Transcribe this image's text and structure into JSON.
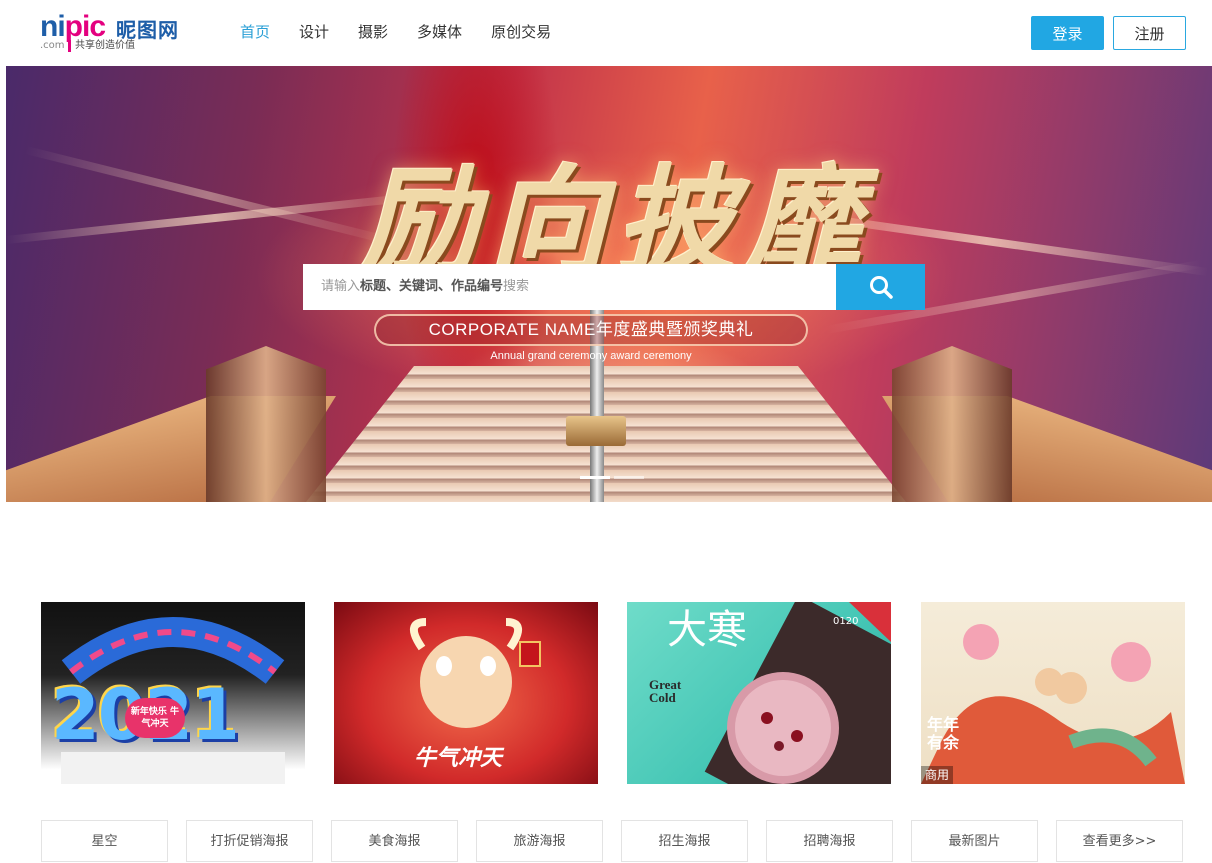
{
  "header": {
    "logo": {
      "ni": "ni",
      "pic": "pic",
      "cn": "昵图网",
      "com": ".com",
      "slogan": "共享创造价值"
    },
    "nav": [
      {
        "label": "首页",
        "active": true
      },
      {
        "label": "设计"
      },
      {
        "label": "摄影"
      },
      {
        "label": "多媒体"
      },
      {
        "label": "原创交易"
      }
    ],
    "login_label": "登录",
    "register_label": "注册"
  },
  "banner": {
    "title": "励向披靡",
    "search": {
      "hint_a": "请输入",
      "hint_b": "标题、关键词、作品编号",
      "hint_c": "搜索"
    },
    "corp_text": "CORPORATE NAME年度盛典暨颁奖典礼",
    "corp_sub": "Annual grand ceremony award ceremony",
    "slides": 2,
    "active_slide": 0
  },
  "thumbnails": [
    {
      "text": "2021",
      "sub": "新年快乐 牛气冲天"
    },
    {
      "text": "牛气冲天"
    },
    {
      "text": "大寒",
      "sub": "Great Cold",
      "tag": "0120"
    },
    {
      "text": "年年有余",
      "caption": "商用"
    }
  ],
  "tags": [
    "星空",
    "打折促销海报",
    "美食海报",
    "旅游海报",
    "招生海报",
    "招聘海报",
    "最新图片",
    "查看更多>>"
  ],
  "colors": {
    "accent": "#21a7e3",
    "logo_blue": "#1e5ea8",
    "logo_pink": "#e4007f"
  }
}
